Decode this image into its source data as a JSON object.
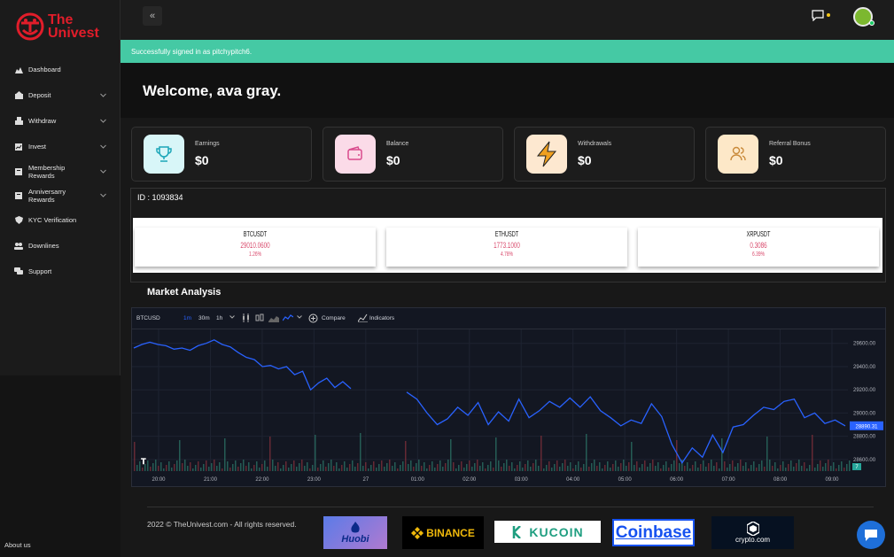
{
  "brand": {
    "line1": "The",
    "line2": "Univest"
  },
  "sidebar": {
    "items": [
      {
        "label": "Dashboard",
        "icon": "dashboard-icon",
        "chevron": false
      },
      {
        "label": "Deposit",
        "icon": "deposit-icon",
        "chevron": true
      },
      {
        "label": "Withdraw",
        "icon": "withdraw-icon",
        "chevron": true
      },
      {
        "label": "Invest",
        "icon": "invest-icon",
        "chevron": true
      },
      {
        "label": "Membership Rewards",
        "icon": "membership-icon",
        "chevron": true
      },
      {
        "label": "Anniversarry Rewards",
        "icon": "anniversary-icon",
        "chevron": true
      },
      {
        "label": "KYC Verification",
        "icon": "kyc-icon",
        "chevron": false
      },
      {
        "label": "Downlines",
        "icon": "downlines-icon",
        "chevron": false
      },
      {
        "label": "Support",
        "icon": "support-icon",
        "chevron": false
      }
    ],
    "about": "About us"
  },
  "topbar": {
    "collapse": "«"
  },
  "alert": "Successfully signed in as pitchypitch6.",
  "welcome": "Welcome, ava gray.",
  "cards": [
    {
      "label": "Earnings",
      "value": "$0",
      "icon": "trophy-icon",
      "bg": "#d8f6f8",
      "color": "#1aa6b8"
    },
    {
      "label": "Balance",
      "value": "$0",
      "icon": "wallet-icon",
      "bg": "#fbdbe8",
      "color": "#d94a8c"
    },
    {
      "label": "Withdrawals",
      "value": "$0",
      "icon": "lightning-icon",
      "bg": "#fde8d0",
      "color": "#f0a020"
    },
    {
      "label": "Referral Bonus",
      "value": "$0",
      "icon": "users-icon",
      "bg": "#fde8c8",
      "color": "#c98a3a"
    }
  ],
  "ticker": {
    "id_label": "ID : 1093834",
    "items": [
      {
        "symbol": "BTCUSDT",
        "price": "29010.0600",
        "change": "1.26%"
      },
      {
        "symbol": "ETHUSDT",
        "price": "1773.1000",
        "change": "4.78%"
      },
      {
        "symbol": "XRPUSDT",
        "price": "0.3086",
        "change": "6.39%"
      }
    ]
  },
  "market": {
    "title": "Market Analysis",
    "toolbar": {
      "symbol": "BTCUSD",
      "intervals": [
        "1m",
        "30m",
        "1h"
      ],
      "compare": "Compare",
      "indicators": "Indicators"
    }
  },
  "chart_data": {
    "type": "line",
    "title": "",
    "xlabel": "",
    "ylabel": "",
    "x_ticks": [
      "20:00",
      "21:00",
      "22:00",
      "23:00",
      "27",
      "01:00",
      "02:00",
      "03:00",
      "04:00",
      "05:00",
      "06:00",
      "07:00",
      "08:00",
      "09:00"
    ],
    "y_ticks": [
      28600.0,
      28800.0,
      29000.0,
      29200.0,
      29400.0,
      29600.0
    ],
    "ylim": [
      28500,
      29720
    ],
    "last_price": "28890.31",
    "volume_badge": "7",
    "color": "#2962ff",
    "segment1": [
      29560,
      29590,
      29610,
      29590,
      29580,
      29550,
      29560,
      29540,
      29580,
      29600,
      29630,
      29590,
      29570,
      29520,
      29480,
      29460,
      29400,
      29410,
      29380,
      29400,
      29330,
      29360,
      29200,
      29260,
      29300,
      29220,
      29270,
      29210
    ],
    "segment2": [
      29180,
      29120,
      29000,
      28900,
      28950,
      29050,
      28980,
      29090,
      28900,
      29010,
      28930,
      29120,
      28960,
      29020,
      29100,
      29050,
      29130,
      29050,
      29140,
      29020,
      28960,
      28890,
      28940,
      28910,
      29080,
      28970,
      28730,
      28570,
      28700,
      28620,
      28810,
      28660,
      28880,
      28900,
      28980,
      29050,
      29030,
      29100,
      29120,
      28960,
      29000,
      28910,
      28940,
      28890
    ]
  },
  "footer": {
    "copyright": "2022 © TheUnivest.com - All rights reserved.",
    "brands": [
      "Huobi",
      "BINANCE",
      "KUCOIN",
      "Coinbase",
      "crypto.com"
    ]
  }
}
